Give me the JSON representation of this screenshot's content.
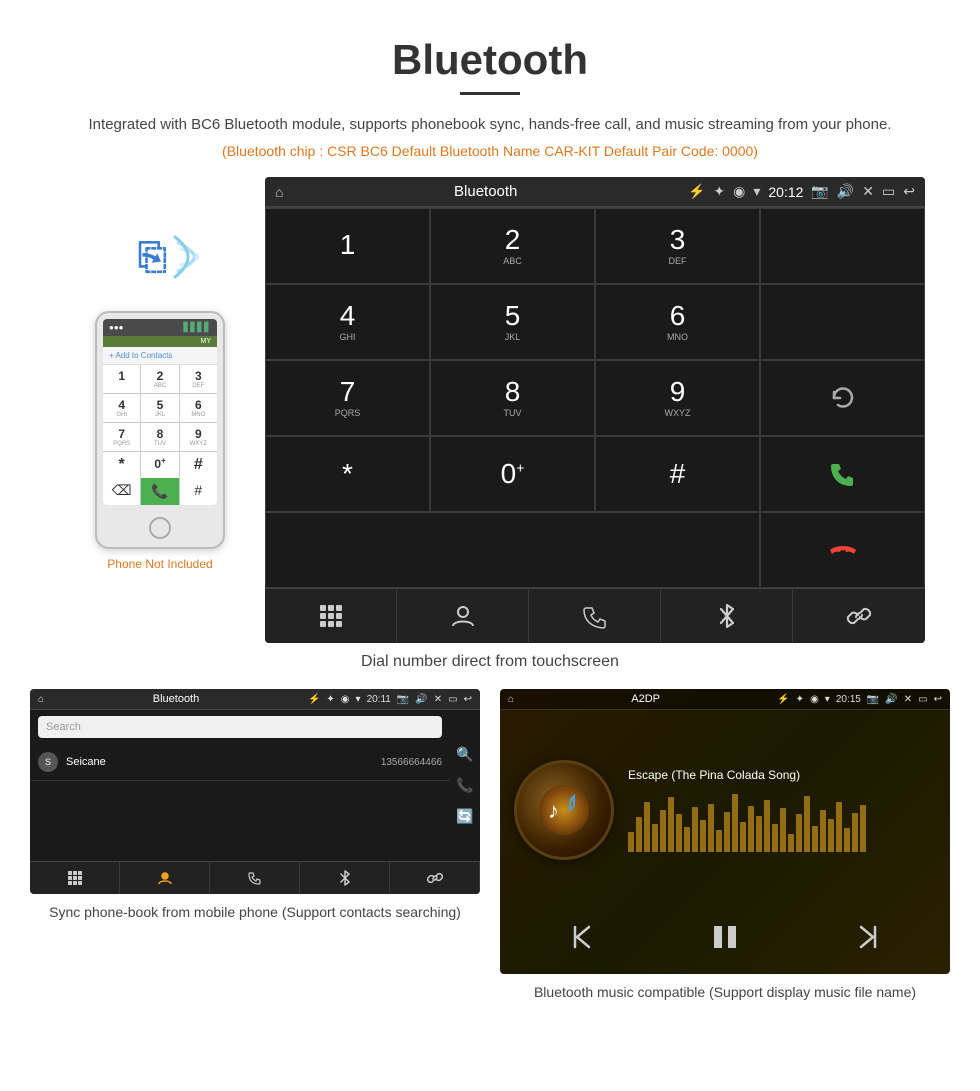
{
  "title": "Bluetooth",
  "description": "Integrated with BC6 Bluetooth module, supports phonebook sync, hands-free call, and music streaming from your phone.",
  "spec_line": "(Bluetooth chip : CSR BC6    Default Bluetooth Name CAR-KIT    Default Pair Code: 0000)",
  "main_caption": "Dial number direct from touchscreen",
  "phone_not_included": "Phone Not Included",
  "car_screen": {
    "topbar": {
      "title": "Bluetooth",
      "time": "20:12"
    },
    "dialpad": [
      {
        "key": "1",
        "sub": ""
      },
      {
        "key": "2",
        "sub": "ABC"
      },
      {
        "key": "3",
        "sub": "DEF"
      },
      {
        "key": "",
        "sub": ""
      },
      {
        "key": "4",
        "sub": "GHI"
      },
      {
        "key": "5",
        "sub": "JKL"
      },
      {
        "key": "6",
        "sub": "MNO"
      },
      {
        "key": "",
        "sub": ""
      },
      {
        "key": "7",
        "sub": "PQRS"
      },
      {
        "key": "8",
        "sub": "TUV"
      },
      {
        "key": "9",
        "sub": "WXYZ"
      },
      {
        "key": "",
        "sub": ""
      },
      {
        "key": "*",
        "sub": ""
      },
      {
        "key": "0",
        "sub": "+"
      },
      {
        "key": "#",
        "sub": ""
      },
      {
        "key": "",
        "sub": ""
      }
    ]
  },
  "phonebook_screen": {
    "topbar_title": "Bluetooth",
    "search_placeholder": "Search",
    "contact": {
      "letter": "S",
      "name": "Seicane",
      "number": "13566664466"
    }
  },
  "music_screen": {
    "topbar_title": "A2DP",
    "song_title": "Escape (The Pina Colada Song)",
    "time": "20:15"
  },
  "bottom_left_caption": "Sync phone-book from mobile phone\n(Support contacts searching)",
  "bottom_right_caption": "Bluetooth music compatible\n(Support display music file name)",
  "colors": {
    "accent": "#e07820",
    "green": "#4CAF50",
    "red": "#f44336",
    "blue_bt": "#4a9fd4"
  }
}
